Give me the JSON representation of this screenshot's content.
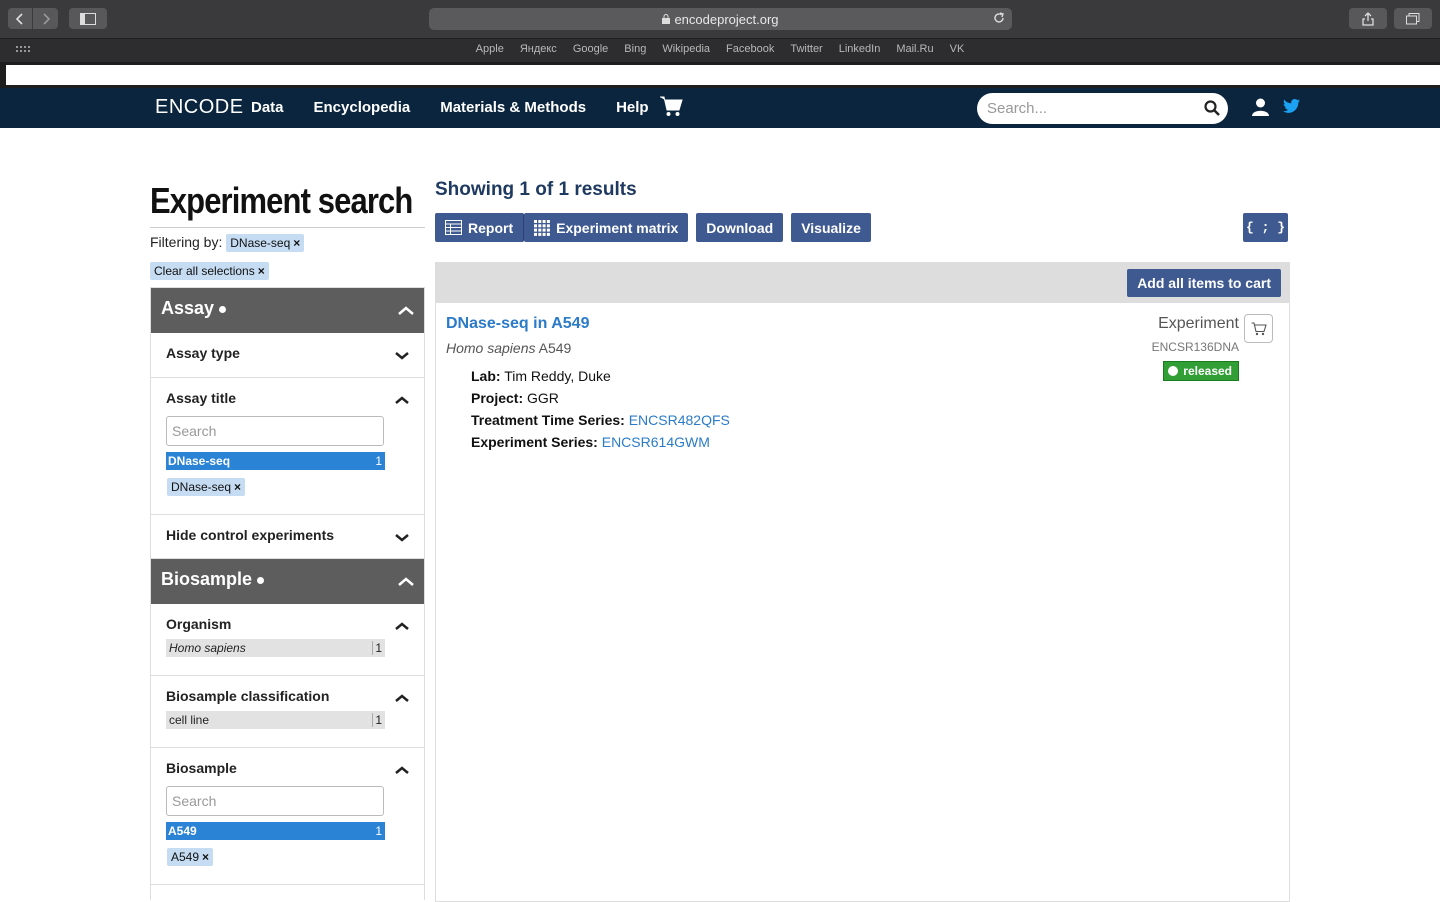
{
  "browser": {
    "url": "encodeproject.org",
    "favorites": [
      "Apple",
      "Яндекс",
      "Google",
      "Bing",
      "Wikipedia",
      "Facebook",
      "Twitter",
      "LinkedIn",
      "Mail.Ru",
      "VK"
    ]
  },
  "nav": {
    "brand": "ENCODE",
    "menu": [
      "Data",
      "Encyclopedia",
      "Materials & Methods",
      "Help"
    ],
    "search_placeholder": "Search..."
  },
  "sidebar": {
    "title": "Experiment search",
    "filtering_label": "Filtering by:",
    "filter_chip": "DNase-seq",
    "clear_all": "Clear all selections",
    "assay_group": "Assay",
    "assay_type": "Assay type",
    "assay_title": "Assay title",
    "assay_search_placeholder": "Search",
    "assay_term": {
      "label": "DNase-seq",
      "count": "1"
    },
    "assay_selected_chip": "DNase-seq",
    "hide_controls": "Hide control experiments",
    "biosample_group": "Biosample",
    "organism": "Organism",
    "organism_term": {
      "label": "Homo sapiens",
      "count": "1"
    },
    "classification": "Biosample classification",
    "classification_term": {
      "label": "cell line",
      "count": "1"
    },
    "biosample": "Biosample",
    "biosample_search_placeholder": "Search",
    "biosample_term": {
      "label": "A549",
      "count": "1"
    },
    "biosample_selected_chip": "A549"
  },
  "results": {
    "heading": "Showing 1 of 1 results",
    "buttons": [
      "Report",
      "Experiment matrix",
      "Download",
      "Visualize"
    ],
    "json_button": "{ ; }",
    "add_all": "Add all items to cart",
    "item": {
      "title": "DNase-seq in A549",
      "organism": "Homo sapiens",
      "biosample": "A549",
      "type": "Experiment",
      "accession": "ENCSR136DNA",
      "status": "released",
      "lab_label": "Lab:",
      "lab": "Tim Reddy, Duke",
      "project_label": "Project:",
      "project": "GGR",
      "treatment_label": "Treatment Time Series:",
      "treatment": "ENCSR482QFS",
      "series_label": "Experiment Series:",
      "series": "ENCSR614GWM"
    }
  },
  "colors": {
    "nav_bg": "#0a253d",
    "button_bg": "#3f5a91",
    "link": "#2b7bc8",
    "selected_term": "#2a83d5",
    "status_released": "#329f36"
  }
}
